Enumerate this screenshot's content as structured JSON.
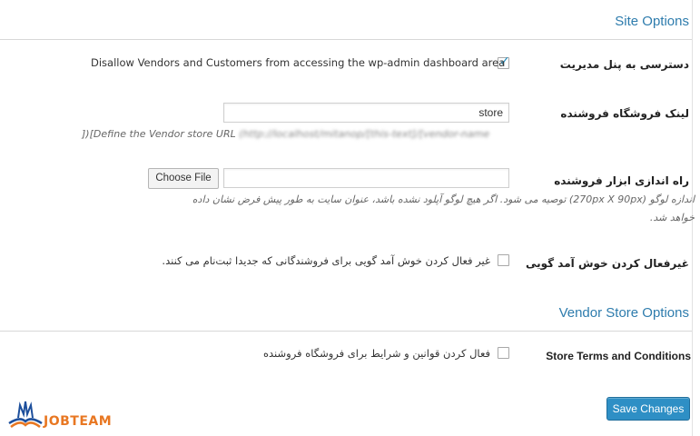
{
  "site_options": {
    "title": "Site Options",
    "admin_access": {
      "label": "دسترسی به پنل مدیریت",
      "checkbox_text": "Disallow Vendors and Customers from accessing the wp-admin dashboard area",
      "checked": true
    },
    "store_link": {
      "label": "لینک فروشگاه فروشنده",
      "input_value": "store",
      "description_prefix": "[Define the Vendor store URL",
      "description_blurred": "(http://localhost/mitanop/[this-text]/[vendor-name",
      "description_suffix": "])"
    },
    "toolbar_setup": {
      "label": "راه اندازی ابزار فروشنده",
      "choose_file_label": "Choose File",
      "description": "اندازه لوگو (270px X 90px) توصیه می شود. اگر هیچ لوگو آپلود نشده باشد، عنوان سایت به طور پیش فرض نشان داده خواهد شد."
    },
    "disable_welcome": {
      "label": "غیرفعال کردن خوش آمد گویی",
      "checkbox_text": "غیر فعال کردن خوش آمد گویی برای فروشندگانی که جدیدا ثبت‌نام می کنند.",
      "checked": false
    }
  },
  "vendor_store_options": {
    "title": "Vendor Store Options",
    "terms": {
      "label": "Store Terms and Conditions",
      "checkbox_text": "فعال کردن قوانین و شرایط برای فروشگاه فروشنده",
      "checked": false
    }
  },
  "save_button": {
    "label": "Save Changes"
  },
  "watermark": {
    "text": "JOBTEAM"
  },
  "colors": {
    "accent": "#2e7cad",
    "button": "#2e8fc5",
    "checkmark": "#1e8cbe",
    "watermark_orange": "#e87722",
    "watermark_blue": "#1d4f9c"
  }
}
